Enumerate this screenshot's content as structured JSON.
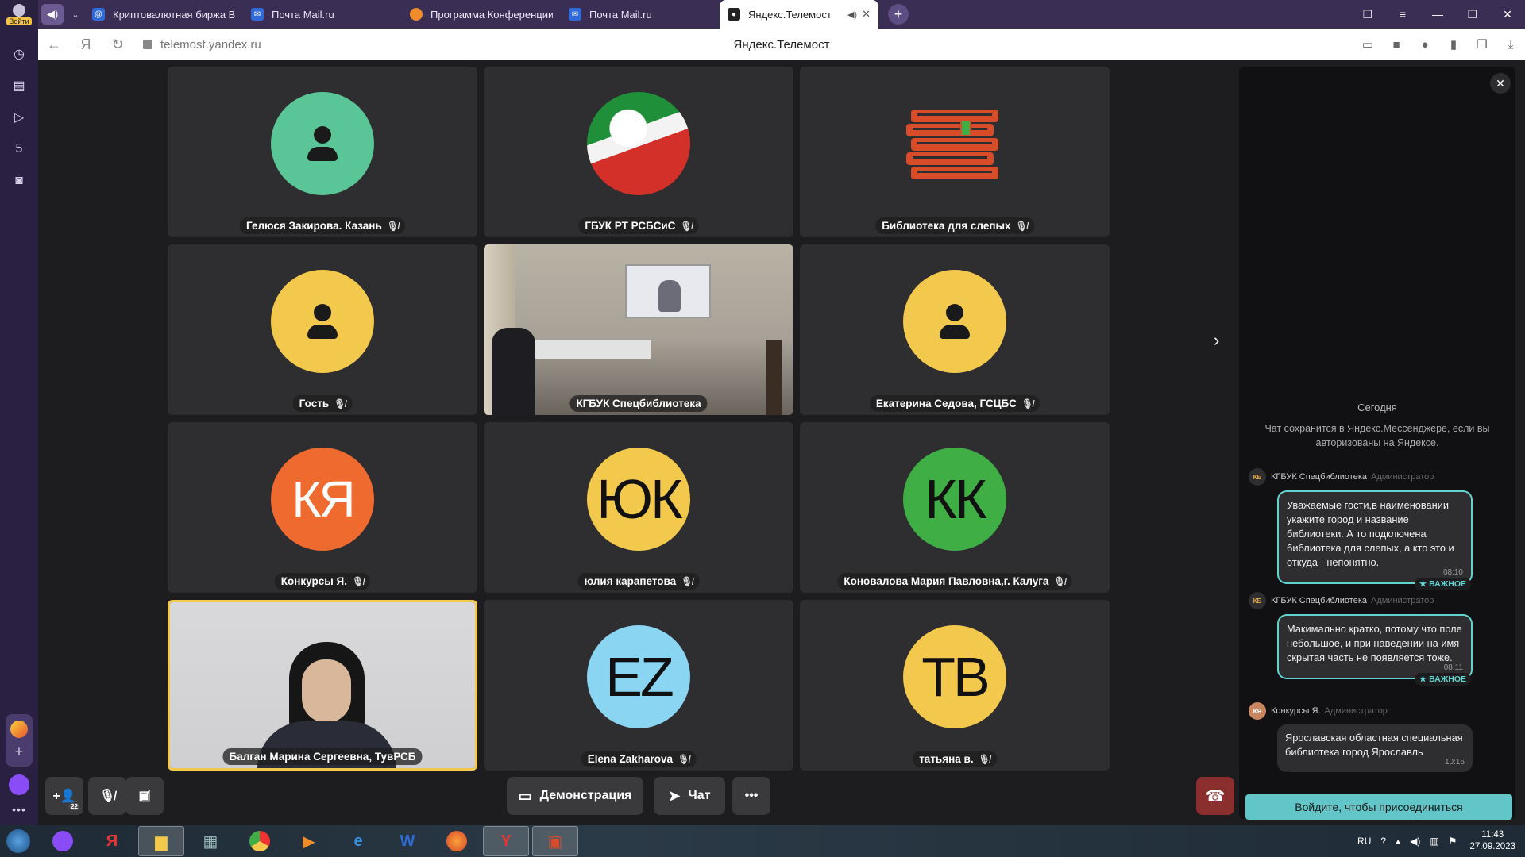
{
  "browser": {
    "login_label": "Войти",
    "tabs": [
      {
        "title": "Криптовалютная биржа B",
        "favicon_color": "#2f6bd8"
      },
      {
        "title": "Почта Mail.ru",
        "favicon_color": "#2f6bd8"
      },
      {
        "title": "Программа Конференции",
        "favicon_color": "#f08c2a"
      },
      {
        "title": "Почта Mail.ru",
        "favicon_color": "#2f6bd8"
      },
      {
        "title": "Яндекс.Телемост",
        "favicon_color": "#222222",
        "active": true
      }
    ],
    "url": "telemost.yandex.ru",
    "page_title": "Яндекс.Телемост"
  },
  "participants": [
    {
      "name": "Гелюся Закирова. Казань",
      "type": "icon",
      "color": "#5ac596"
    },
    {
      "name": "ГБУК РТ РСБСиС",
      "type": "flag"
    },
    {
      "name": "Библиотека для слепых",
      "type": "logo"
    },
    {
      "name": "Гость",
      "type": "icon",
      "color": "#f2c94c"
    },
    {
      "name": "КГБУК Спецбиблиотека",
      "type": "video-room"
    },
    {
      "name": "Екатерина Седова, ГСЦБС",
      "type": "icon",
      "color": "#f2c94c"
    },
    {
      "name": "Конкурсы Я.",
      "type": "initials",
      "initials": "КЯ",
      "color": "#ef6a2e"
    },
    {
      "name": "юлия карапетова",
      "type": "initials",
      "initials": "ЮК",
      "color": "#f2c94c"
    },
    {
      "name": "Коновалова Мария Павловна,г. Калуга",
      "type": "initials",
      "initials": "КК",
      "color": "#3fae45"
    },
    {
      "name": "Балган Марина Сергеевна, ТувРСБ",
      "type": "video-woman",
      "speaking": true
    },
    {
      "name": "Elena Zakharova",
      "type": "initials",
      "initials": "EZ",
      "color": "#8ad6f2"
    },
    {
      "name": "татьяна в.",
      "type": "initials",
      "initials": "ТВ",
      "color": "#f2c94c"
    }
  ],
  "controls": {
    "participants_count": "22",
    "demo_label": "Демонстрация",
    "chat_label": "Чат"
  },
  "chat": {
    "today_label": "Сегодня",
    "notice": "Чат сохранится в Яндекс.Мессенджере, если вы авторизованы на Яндексе.",
    "messages": [
      {
        "avatar": "КБ",
        "author": "КГБУК Спецбиблиотека",
        "role": "Администратор",
        "text": "Уважаемые гости,в наименовании укажите город и название библиотеки. А то подключена библиотека для слепых, а кто это и откуда - непонятно.",
        "time": "08:10",
        "important": true
      },
      {
        "avatar": "КБ",
        "author": "КГБУК Спецбиблиотека",
        "role": "Администратор",
        "text": "Макимально кратко, потому что поле небольшое, и при наведении на имя скрытая часть не появляется тоже.",
        "time": "08:11",
        "important": true
      },
      {
        "avatar": "КЯ",
        "author": "Конкурсы Я.",
        "role": "Администратор",
        "text": "Ярославская областная специальная библиотека город Ярославль",
        "time": "10:15",
        "important": false
      }
    ],
    "important_label": "★ ВАЖНОЕ",
    "join_label": "Войдите, чтобы присоединиться"
  },
  "taskbar": {
    "lang": "RU",
    "time": "11:43",
    "date": "27.09.2023"
  }
}
